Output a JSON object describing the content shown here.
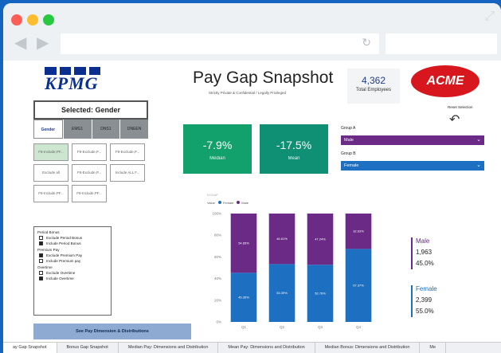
{
  "browser": {
    "traffic_lights": [
      "#ff5f57",
      "#febc2e",
      "#28c840"
    ],
    "back_icon": "chevron-left",
    "forward_icon": "chevron-right",
    "reload_icon": "reload",
    "reload_glyph": "↻",
    "expand_glyph": "⤢",
    "url": ""
  },
  "report": {
    "logo": "KPMG",
    "selected": "Selected: Gender",
    "dimension_tabs": [
      "Gender",
      "EMG1",
      "DNS1",
      "DNEEN"
    ],
    "filter_buttons": [
      "F8-Include,PF...",
      "F8-Exclude,P...",
      "F8-Exclude,P...",
      "Exclude all",
      "F8-Exclude,P...",
      "Include ALL F...",
      "F8-Include,PF...",
      "F8-Include,PF..."
    ],
    "title": "Pay Gap Snapshot",
    "subtitle": "Strictly Private & Confidential / Legally Privileged",
    "total_employees_value": "4,362",
    "total_employees_label": "Total Employees",
    "acme_logo": "ACME",
    "reset_label": "Reset Selection",
    "reset_glyph": "↶",
    "median": {
      "value": "-7.9%",
      "label": "Median"
    },
    "mean": {
      "value": "-17.5%",
      "label": "Mean"
    },
    "group_a_label": "Group A",
    "group_a_value": "Male",
    "group_b_label": "Group B",
    "group_b_value": "Female",
    "chevron_glyph": "⌄",
    "chart_caption": "ECDAP",
    "legend": {
      "prefix": "Value",
      "female": "Female",
      "male": "Male"
    },
    "options": {
      "period_bonus_h": "Period Bonus",
      "exclude_period_bonus": "Exclude Period Bonus",
      "include_period_bonus": "Include Period Bonus",
      "premium_pay_h": "Premium Pay",
      "exclude_premium_pay": "Exclude Premium Pay",
      "include_premium_pay": "Include Premium pay",
      "overtime_h": "Overtime",
      "exclude_overtime": "Exclude Overtime",
      "include_overtime": "Include Overtime"
    },
    "checked": {
      "exclude_period_bonus": false,
      "include_period_bonus": true,
      "exclude_premium_pay": true,
      "include_premium_pay": false,
      "exclude_overtime": false,
      "include_overtime": true
    },
    "nav_button": "See Pay Dimension & Distributions",
    "male_summary": {
      "label": "Male",
      "count": "1,963",
      "pct": "45.0%"
    },
    "female_summary": {
      "label": "Female",
      "count": "2,399",
      "pct": "55.0%"
    },
    "colors": {
      "male": "#6a2a86",
      "female": "#1d6fc2",
      "median_tile": "#12a06d",
      "mean_tile": "#0f8f74"
    }
  },
  "page_tabs": [
    "ay Gap Snapshot",
    "Bonus Gap Snapshot",
    "Median Pay: Dimensions and Distribution",
    "Mean Pay: Dimensions and Distribution",
    "Median Bonus: Dimensions and Distribution",
    "Me"
  ],
  "chart_data": {
    "type": "bar",
    "stacked": true,
    "categories": [
      "Q1",
      "Q2",
      "Q3",
      "Q4"
    ],
    "series": [
      {
        "name": "Female",
        "values": [
          45.35,
          53.39,
          52.76,
          67.37
        ],
        "labels": [
          "45.35%",
          "53.39%",
          "52.76%",
          "67.37%"
        ]
      },
      {
        "name": "Male",
        "values": [
          54.65,
          46.61,
          47.24,
          32.63
        ],
        "labels": [
          "54.65%",
          "46.61%",
          "47.24%",
          "32.63%"
        ]
      }
    ],
    "y_ticks": [
      "100%",
      "80%",
      "60%",
      "40%",
      "20%",
      "0%"
    ],
    "ylim": [
      0,
      100
    ],
    "grid": false
  }
}
